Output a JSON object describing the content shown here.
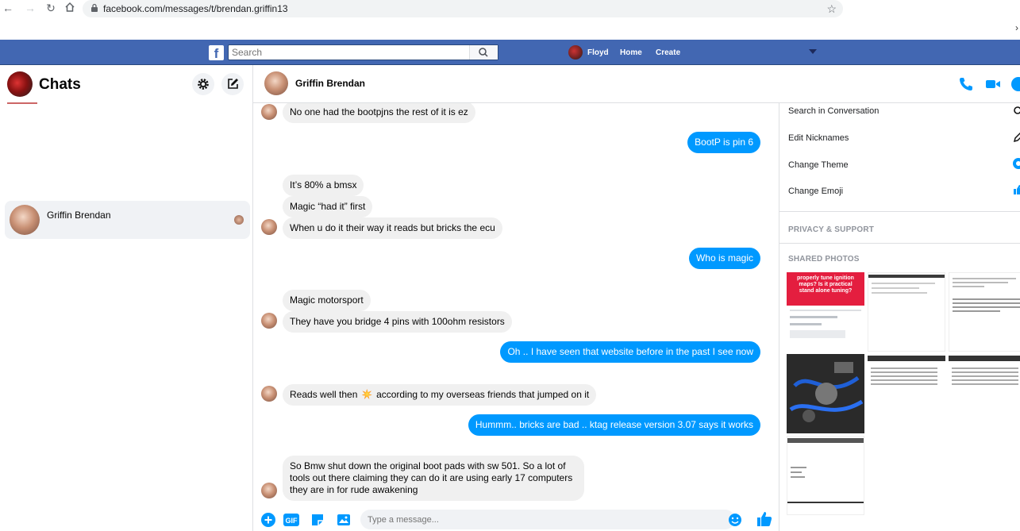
{
  "browser": {
    "url": "facebook.com/messages/t/brendan.griffin13",
    "back_icon": "arrow-left-icon",
    "forward_icon": "arrow-right-icon",
    "reload_icon": "reload-icon",
    "home_icon": "home-icon",
    "bookmark_icon": "star-icon"
  },
  "fbbar": {
    "search_placeholder": "Search",
    "profile_name": "Floyd",
    "home_label": "Home",
    "create_label": "Create",
    "colors": {
      "bar": "#4267b2"
    }
  },
  "sidebar": {
    "title": "Chats",
    "conversations": [
      {
        "name": "Griffin Brendan"
      }
    ]
  },
  "conversation": {
    "contact_name": "Griffin Brendan",
    "messages": [
      {
        "dir": "in",
        "text": "No one had the bootpjns the rest of it is ez"
      },
      {
        "dir": "out",
        "text": "BootP is pin 6"
      },
      {
        "dir": "in",
        "text": "It’s 80% a bmsx"
      },
      {
        "dir": "in",
        "text": "Magic “had it” first"
      },
      {
        "dir": "in",
        "text": "When u do it their way  it reads but bricks the ecu"
      },
      {
        "dir": "out",
        "text": "Who is magic"
      },
      {
        "dir": "in",
        "text": "Magic motorsport"
      },
      {
        "dir": "in",
        "text": "They have you bridge 4 pins with 100ohm resistors"
      },
      {
        "dir": "out",
        "text": "Oh .. I have seen that website before in the past I see now"
      },
      {
        "dir": "in",
        "text_before": "Reads well then",
        "text_after": "according to my overseas friends that jumped on it"
      },
      {
        "dir": "out",
        "text": "Hummm.. bricks are bad .. ktag release version 3.07 says it works"
      },
      {
        "dir": "in",
        "text": "So Bmw shut down the original boot pads with sw 501. So a lot of tools out there claiming they can do it are using early 17 computers  they are in for rude awakening"
      }
    ],
    "composer_placeholder": "Type a message...",
    "colors": {
      "outgoing": "#0099ff",
      "incoming": "#f0f0f0"
    }
  },
  "details": {
    "options": [
      {
        "label": "Search in Conversation",
        "icon": "search-icon"
      },
      {
        "label": "Edit Nicknames",
        "icon": "pencil-icon"
      },
      {
        "label": "Change Theme",
        "icon": "theme-circle-icon"
      },
      {
        "label": "Change Emoji",
        "icon": "thumbs-up-icon"
      }
    ],
    "privacy_label": "PRIVACY & SUPPORT",
    "photos_label": "SHARED PHOTOS",
    "photo1_caption": "properly tune ignition maps? Is it practical stand alone tuning?"
  }
}
